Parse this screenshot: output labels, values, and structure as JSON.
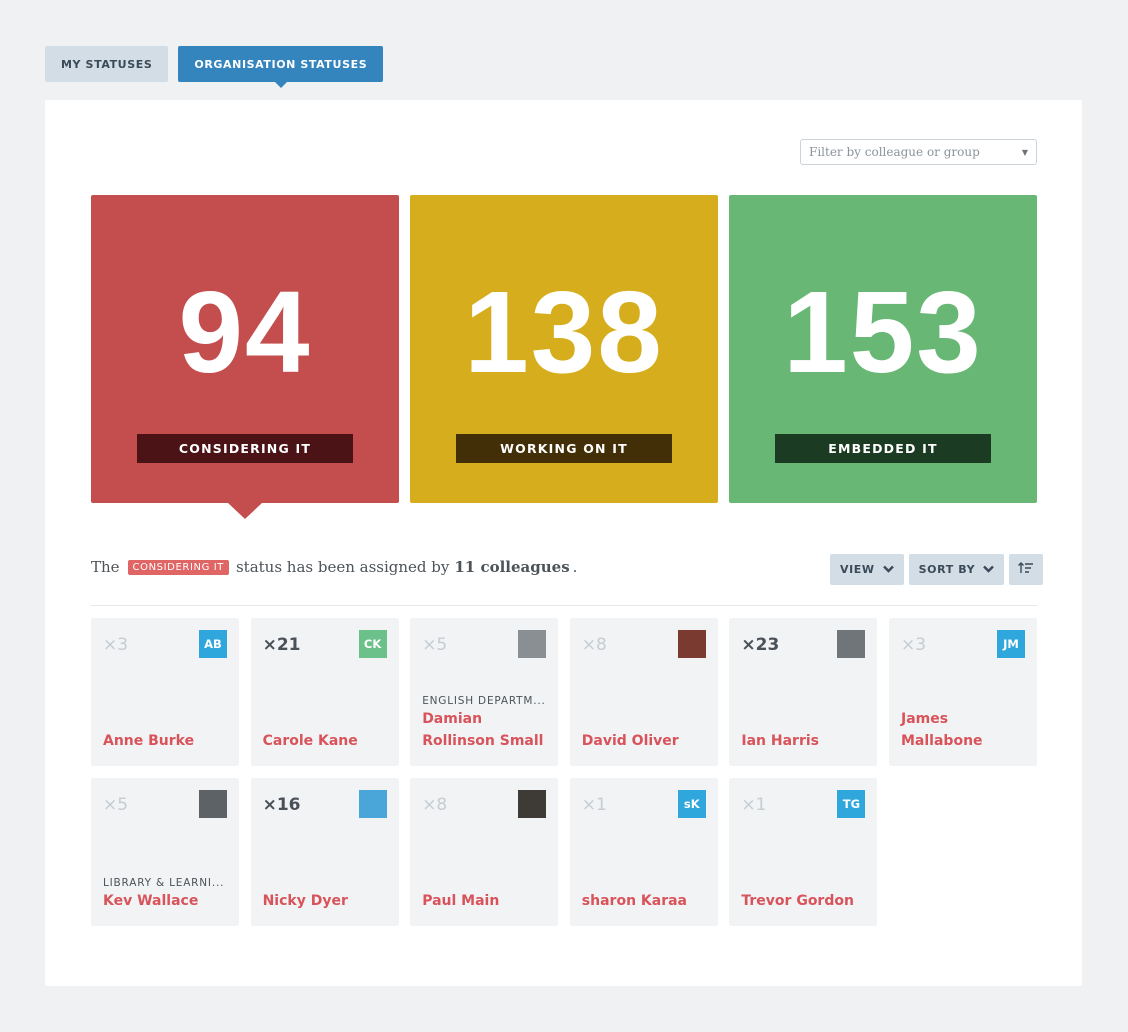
{
  "tabs": {
    "my_statuses": "MY STATUSES",
    "organisation_statuses": "ORGANISATION STATUSES"
  },
  "filter": {
    "placeholder": "Filter by colleague or group"
  },
  "stats": [
    {
      "value": "94",
      "label": "CONSIDERING IT",
      "color": "#c44e4e"
    },
    {
      "value": "138",
      "label": "WORKING ON IT",
      "color": "#d6ae1d"
    },
    {
      "value": "153",
      "label": "EMBEDDED IT",
      "color": "#68b775"
    }
  ],
  "summary": {
    "prefix": "The",
    "badge": "CONSIDERING IT",
    "middle": "status has been assigned by",
    "count": "11 colleagues",
    "suffix": "."
  },
  "controls": {
    "view": "VIEW",
    "sort_by": "SORT BY",
    "sort_icon": "sort-order-icon"
  },
  "colleagues": [
    {
      "count": "×3",
      "initials": "AB",
      "avatar_color": "#2fa7dd",
      "group": "",
      "name": "Anne Burke"
    },
    {
      "count": "×21",
      "initials": "CK",
      "avatar_color": "#6cc08a",
      "group": "",
      "name": "Carole Kane"
    },
    {
      "count": "×5",
      "initials": "",
      "avatar_color": "#8a8f93",
      "group": "ENGLISH DEPARTM...",
      "name": "Damian Rollinson Small"
    },
    {
      "count": "×8",
      "initials": "",
      "avatar_color": "#7b3a2f",
      "group": "",
      "name": "David Oliver"
    },
    {
      "count": "×23",
      "initials": "",
      "avatar_color": "#6f7579",
      "group": "",
      "name": "Ian Harris"
    },
    {
      "count": "×3",
      "initials": "JM",
      "avatar_color": "#2fa7dd",
      "group": "",
      "name": "James Mallabone"
    },
    {
      "count": "×5",
      "initials": "",
      "avatar_color": "#5d6266",
      "group": "LIBRARY & LEARNI...",
      "name": "Kev Wallace"
    },
    {
      "count": "×16",
      "initials": "",
      "avatar_color": "#4aa6d8",
      "group": "",
      "name": "Nicky Dyer"
    },
    {
      "count": "×8",
      "initials": "",
      "avatar_color": "#3e3a36",
      "group": "",
      "name": "Paul Main"
    },
    {
      "count": "×1",
      "initials": "sK",
      "avatar_color": "#2fa7dd",
      "group": "",
      "name": "sharon Karaa"
    },
    {
      "count": "×1",
      "initials": "TG",
      "avatar_color": "#2fa7dd",
      "group": "",
      "name": "Trevor Gordon"
    }
  ]
}
